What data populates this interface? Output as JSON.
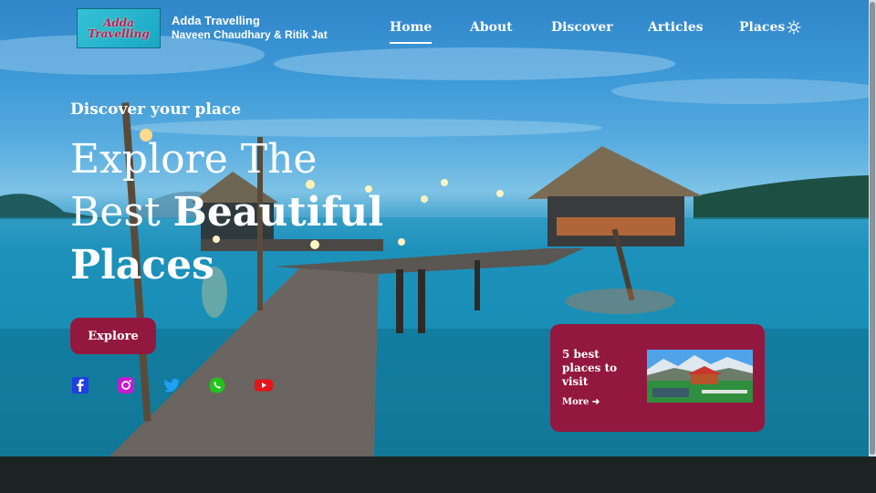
{
  "brand": {
    "logo_text_line1": "Adda",
    "logo_text_line2": "Travelling",
    "name": "Adda Travelling",
    "authors": "Naveen Chaudhary & Ritik Jat"
  },
  "nav": {
    "items": [
      {
        "label": "Home",
        "active": true
      },
      {
        "label": "About",
        "active": false
      },
      {
        "label": "Discover",
        "active": false
      },
      {
        "label": "Articles",
        "active": false
      },
      {
        "label": "Places",
        "active": false
      }
    ],
    "theme_icon": "sun-icon"
  },
  "hero": {
    "subtitle": "Discover your place",
    "headline_part1": "Explore The",
    "headline_part2": "Best ",
    "headline_bold1": "Beautiful",
    "headline_bold2": "Places",
    "cta_label": "Explore"
  },
  "social": [
    {
      "icon": "facebook-icon",
      "color": "#1f3fe0"
    },
    {
      "icon": "instagram-icon",
      "color": "#c41bd1"
    },
    {
      "icon": "twitter-icon",
      "color": "#1da1f2"
    },
    {
      "icon": "whatsapp-icon",
      "color": "#20c41c"
    },
    {
      "icon": "youtube-icon",
      "color": "#e3141b"
    }
  ],
  "card": {
    "title": "5 best places to visit",
    "more_label": "More"
  },
  "colors": {
    "accent": "#93183f",
    "footer": "#1b2422"
  }
}
